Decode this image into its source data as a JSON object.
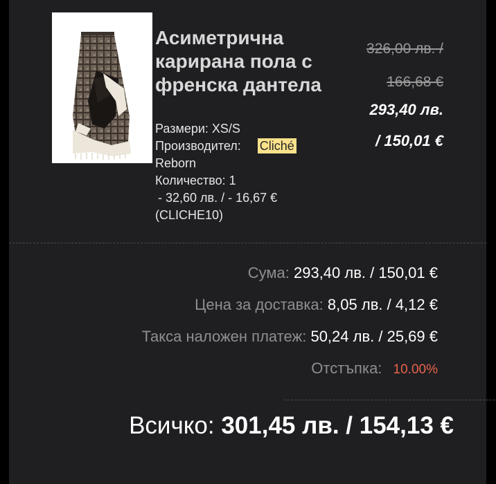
{
  "product": {
    "title": "Асиметрична карирана пола с френска дантела",
    "old_price_bgn": "326,00 лв. /",
    "old_price_eur": "166,68 €",
    "new_price_bgn": "293,40 лв.",
    "new_price_eur": "/ 150,01 €",
    "size_label": "Размери: XS/S",
    "manufacturer_label": "Производител:",
    "manufacturer_brand": "Cliché",
    "manufacturer_suffix": "Reborn",
    "quantity_label": "Количество: 1",
    "discount_amount": "- 32,60 лв. / - 16,67 €",
    "discount_code": "(CLICHE10)"
  },
  "summary": {
    "sum_label": "Сума:",
    "sum_value": "293,40 лв. / 150,01 €",
    "shipping_label": "Цена за доставка:",
    "shipping_value": "8,05 лв. / 4,12 €",
    "cod_label": "Такса наложен платеж:",
    "cod_value": "50,24 лв. / 25,69 €",
    "discount_label": "Отстъпка:",
    "discount_value": "10.00%",
    "total_label": "Всичко:",
    "total_value": "301,45 лв. / 154,13 €"
  },
  "colors": {
    "background": "#1f1f22",
    "brand_highlight": "#fbe28b",
    "discount_accent": "#e8634a"
  }
}
